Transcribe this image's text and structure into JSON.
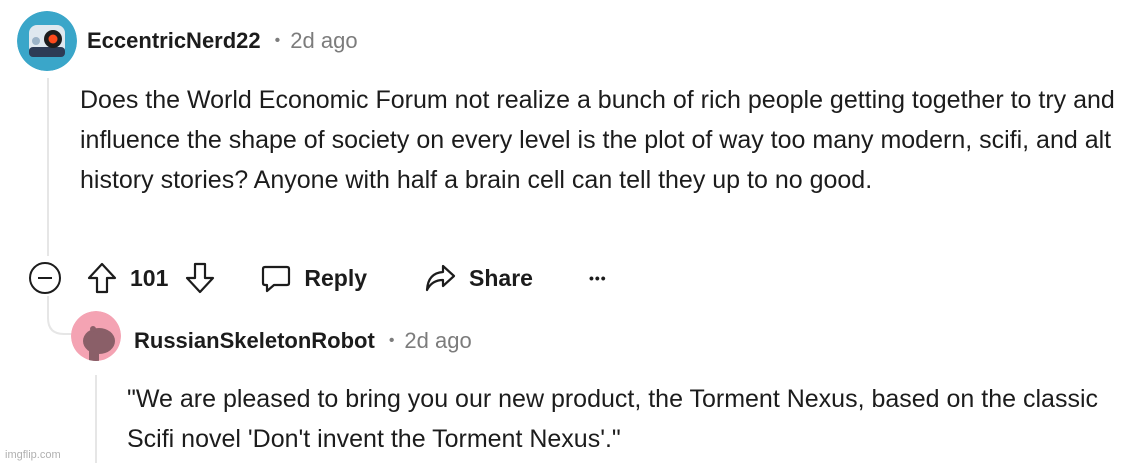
{
  "comment": {
    "username": "EccentricNerd22",
    "separator": "•",
    "time": "2d ago",
    "body": "Does the World Economic Forum not realize a bunch of rich people getting together to try and influence the shape of society on every level is the plot of way too many modern, scifi, and alt history stories? Anyone with half a brain cell can tell they up to no good.",
    "votes": "101",
    "reply_label": "Reply",
    "share_label": "Share",
    "more_label": "•••"
  },
  "reply": {
    "username": "RussianSkeletonRobot",
    "separator": "•",
    "time": "2d ago",
    "body": "\"We are pleased to bring you our new product, the Torment Nexus, based on the classic Scifi novel 'Don't invent the Torment Nexus'.\""
  },
  "watermark": "imgflip.com",
  "colors": {
    "avatar1_bg": "#3aa6c9",
    "avatar2_bg": "#f4a3b3",
    "text": "#1c1c1c",
    "muted": "#7c7c7c",
    "thread": "#e6e6e6"
  },
  "icons": [
    "collapse-icon",
    "upvote-icon",
    "downvote-icon",
    "reply-icon",
    "share-icon",
    "more-icon"
  ]
}
